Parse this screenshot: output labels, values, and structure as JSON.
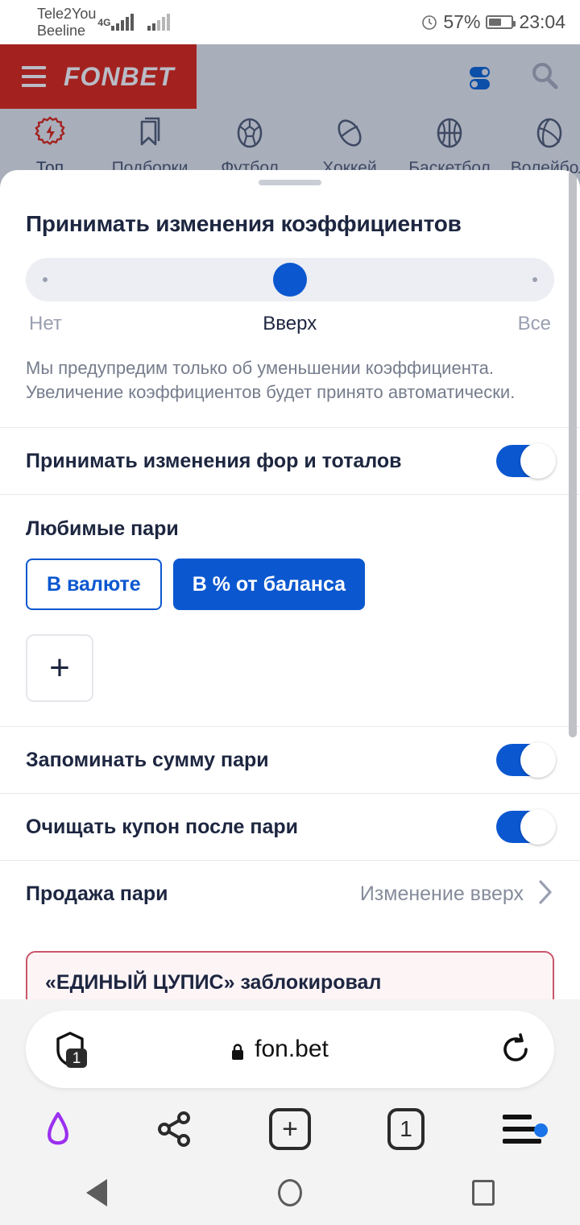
{
  "status_bar": {
    "carrier_primary": "Tele2You",
    "carrier_secondary": "Beeline",
    "network_type": "4G",
    "battery_percent": "57%",
    "time": "23:04",
    "alarm_icon": "alarm-icon",
    "battery_icon": "battery-icon"
  },
  "app_header": {
    "menu_icon": "hamburger-menu-icon",
    "logo": "FONBET",
    "settings_icon": "settings-toggles-icon",
    "search_icon": "search-icon",
    "brand_color": "#a3221f",
    "header_bg": "#a9aebb"
  },
  "sports_nav": {
    "items": [
      {
        "label": "Топ",
        "icon": "lightning-badge-icon"
      },
      {
        "label": "Подборки",
        "icon": "bookmark-icon"
      },
      {
        "label": "Футбол",
        "icon": "soccer-ball-icon"
      },
      {
        "label": "Хоккей",
        "icon": "hockey-puck-icon"
      },
      {
        "label": "Баскетбол",
        "icon": "basketball-icon"
      },
      {
        "label": "Волейбол",
        "icon": "volleyball-icon"
      }
    ]
  },
  "sheet": {
    "grabber": "drag-handle",
    "title": "Принимать изменения коэффициентов",
    "slider": {
      "options": [
        "Нет",
        "Вверх",
        "Все"
      ],
      "selected": "Вверх",
      "selected_index": 1,
      "accent_color": "#0B57D0"
    },
    "hint": "Мы предупредим только об уменьшении коэффициента. Увеличение коэффициентов будет принято автоматически.",
    "rows": [
      {
        "label": "Принимать изменения фор и тоталов",
        "control": "toggle",
        "value": "on"
      },
      {
        "label": "Запоминать сумму пари",
        "control": "toggle",
        "value": "on"
      },
      {
        "label": "Очищать купон после пари",
        "control": "toggle",
        "value": "on"
      },
      {
        "label": "Продажа пари",
        "control": "link",
        "value": "Изменение вверх",
        "chevron": "chevron-right-icon"
      }
    ],
    "favorites": {
      "title": "Любимые пари",
      "chips": [
        {
          "label": "В валюте",
          "state": "inactive"
        },
        {
          "label": "В % от баланса",
          "state": "active"
        }
      ],
      "add_button": "+"
    },
    "warning": "«ЕДИНЫЙ ЦУПИС» заблокировал"
  },
  "browser": {
    "shield_icon": "tracker-shield-icon",
    "shield_count": "1",
    "lock_icon": "lock-icon",
    "url": "fon.bet",
    "reload_icon": "reload-icon",
    "tools": [
      {
        "name": "browser-home-icon",
        "label": ""
      },
      {
        "name": "share-icon",
        "label": ""
      },
      {
        "name": "new-tab-icon",
        "label": "+"
      },
      {
        "name": "tab-switcher-icon",
        "label": "1"
      },
      {
        "name": "browser-menu-icon",
        "label": ""
      }
    ]
  },
  "android_nav": {
    "back": "back-nav-icon",
    "home": "home-nav-icon",
    "recents": "recents-nav-icon"
  }
}
